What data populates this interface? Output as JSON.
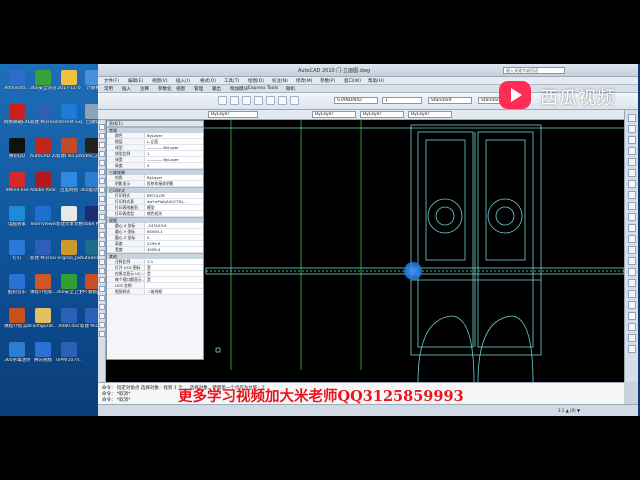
{
  "desktop": {
    "icons": [
      {
        "label": "Administr...",
        "color": "#2e6cc9"
      },
      {
        "label": "360安全浏览器",
        "color": "#3aa03a"
      },
      {
        "label": "2017-11-0",
        "color": "#f0c040"
      },
      {
        "label": "计算机",
        "color": "#4a8fd9"
      },
      {
        "label": "网易邮箱EXE",
        "color": "#c82020"
      },
      {
        "label": "新建 Microsoft...",
        "color": "#2b5fb8"
      },
      {
        "label": "Internet Explorer",
        "color": "#1e7ad6"
      },
      {
        "label": "回收站",
        "color": "#8fa3b8"
      },
      {
        "label": "腾讯QQ",
        "color": "#111111"
      },
      {
        "label": "AutoCAD 2010 - 简...",
        "color": "#c0241c"
      },
      {
        "label": "新建Fla1.pnt",
        "color": "#c24a2a"
      },
      {
        "label": "Video_201...",
        "color": "#222222"
      },
      {
        "label": "XMind.exe",
        "color": "#d42a2a"
      },
      {
        "label": "Adobe Reader 9",
        "color": "#b0191e"
      },
      {
        "label": "百度网盘",
        "color": "#2e8ae0"
      },
      {
        "label": "360驱动大师",
        "color": "#2a7fd4"
      },
      {
        "label": "电脑管家",
        "color": "#1c8cd8"
      },
      {
        "label": "TeamViewer 12",
        "color": "#1f6fd0"
      },
      {
        "label": "新建文本文档.txt",
        "color": "#e8e8e8"
      },
      {
        "label": "Adobe Photosh...",
        "color": "#1b2f6e"
      },
      {
        "label": "钉钉",
        "color": "#2a7ad6"
      },
      {
        "label": "新建 Microsoft...",
        "color": "#2b5fb8"
      },
      {
        "label": "ecgroo_pv",
        "color": "#cc9a2a"
      },
      {
        "label": "Autodesk 3ds Max ...",
        "color": "#1a6c8a"
      },
      {
        "label": "酷狗音乐",
        "color": "#2a72d6"
      },
      {
        "label": "课程介绍新...pptx",
        "color": "#d2552a"
      },
      {
        "label": "360安全卫士",
        "color": "#30a030"
      },
      {
        "label": "PPT模板pptx",
        "color": "#c85020"
      },
      {
        "label": "课程介绍.pptx",
        "color": "#c85020"
      },
      {
        "label": "configurat...",
        "color": "#e0c060"
      },
      {
        "label": "0080.doc",
        "color": "#2b5fb8"
      },
      {
        "label": "新建 Microso...",
        "color": "#2b5fb8"
      },
      {
        "label": "360杀毒迷你版本...",
        "color": "#2a7fd4"
      },
      {
        "label": "腾讯视频",
        "color": "#2a72d6"
      },
      {
        "label": "UPM(1074...",
        "color": "#2b5fb8"
      }
    ]
  },
  "acad": {
    "title": "AutoCAD 2010   门-立面图.dwg",
    "search_placeholder": "键入关键字或短语",
    "menu": [
      "文件(F)",
      "编辑(E)",
      "视图(V)",
      "插入(I)",
      "格式(O)",
      "工具(T)",
      "绘图(D)",
      "标注(N)",
      "修改(M)",
      "参数(P)",
      "窗口(W)",
      "帮助(H)"
    ],
    "tabs": [
      "常用",
      "插入",
      "注释",
      "参数化",
      "视图",
      "管理",
      "输出",
      "附加模块",
      "Express Tools",
      "联机"
    ],
    "layer_value": "ByLayer",
    "style_value": "STANDARD",
    "dim_style": "Standard",
    "scale_value": "1",
    "linetype_value": "ByLayer",
    "lineweight_value": "ByLayer",
    "color_value": "ByLayer"
  },
  "properties": {
    "selector": "直线(1)",
    "sections": [
      {
        "title": "常规",
        "rows": [
          {
            "k": "颜色",
            "v": "ByLayer"
          },
          {
            "k": "图层",
            "v": "L-立面"
          },
          {
            "k": "线型",
            "v": "———— ByLayer"
          },
          {
            "k": "线型比例",
            "v": "1"
          },
          {
            "k": "线宽",
            "v": "———— ByLayer"
          },
          {
            "k": "厚度",
            "v": "0"
          }
        ]
      },
      {
        "title": "三维效果",
        "rows": [
          {
            "k": "材质",
            "v": "ByLayer"
          },
          {
            "k": "阴影显示",
            "v": "投射和接收阴影"
          }
        ]
      },
      {
        "title": "打印样式",
        "rows": [
          {
            "k": "打印样式",
            "v": "BYCOLOR"
          },
          {
            "k": "打印样式表",
            "v": "dwf ePlot(A4)(CTB)..."
          },
          {
            "k": "打印表附着到",
            "v": "模型"
          },
          {
            "k": "打印表类型",
            "v": "颜色相关"
          }
        ]
      },
      {
        "title": "视图",
        "rows": [
          {
            "k": "圆心 X 坐标",
            "v": "-243103.6"
          },
          {
            "k": "圆心 Y 坐标",
            "v": "65093.1"
          },
          {
            "k": "圆心 Z 坐标",
            "v": "0"
          },
          {
            "k": "高度",
            "v": "2299.9"
          },
          {
            "k": "宽度",
            "v": "4558.4"
          }
        ]
      },
      {
        "title": "其他",
        "rows": [
          {
            "k": "注释比例",
            "v": "1:1"
          },
          {
            "k": "打开 UCS 图标",
            "v": "是"
          },
          {
            "k": "在原点显示 UC...",
            "v": "是"
          },
          {
            "k": "每个视口都显示...",
            "v": "是"
          },
          {
            "k": "UCS 名称",
            "v": ""
          },
          {
            "k": "视觉样式",
            "v": "二维线框"
          }
        ]
      }
    ]
  },
  "command": {
    "line1": "命令：  指定对角点  选择对象：找到 1 个 ... 选择对象，使用第一个点作为位移：2",
    "line2": "命令：  *取消*",
    "line3": "命令：  *取消*"
  },
  "status": {
    "text": "1:1  ▲  (0) ▼"
  },
  "watermark": {
    "brand": "西瓜视频",
    "promo": "更多学习视频加大米老师QQ3125859993"
  },
  "colors": {
    "cad_lines": "#6fd4d0",
    "promo_red": "#e8141b",
    "logo_red": "#ff2d55"
  }
}
